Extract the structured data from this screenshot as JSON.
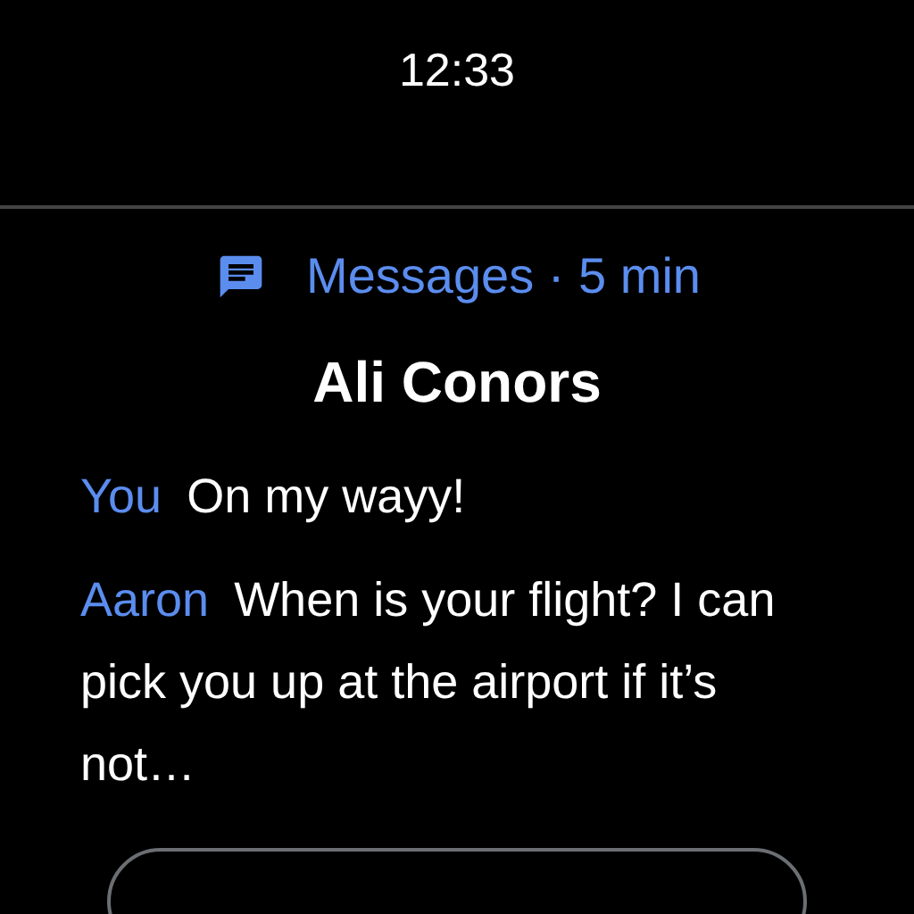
{
  "status_bar": {
    "time": "12:33"
  },
  "notification": {
    "app": "Messages · 5 min",
    "title": "Ali Conors",
    "messages": [
      {
        "sender": "You",
        "text": "On my wayy!"
      },
      {
        "sender": "Aaron",
        "text": "When is your flight? I can pick you up at the airport if it’s not…"
      }
    ]
  }
}
